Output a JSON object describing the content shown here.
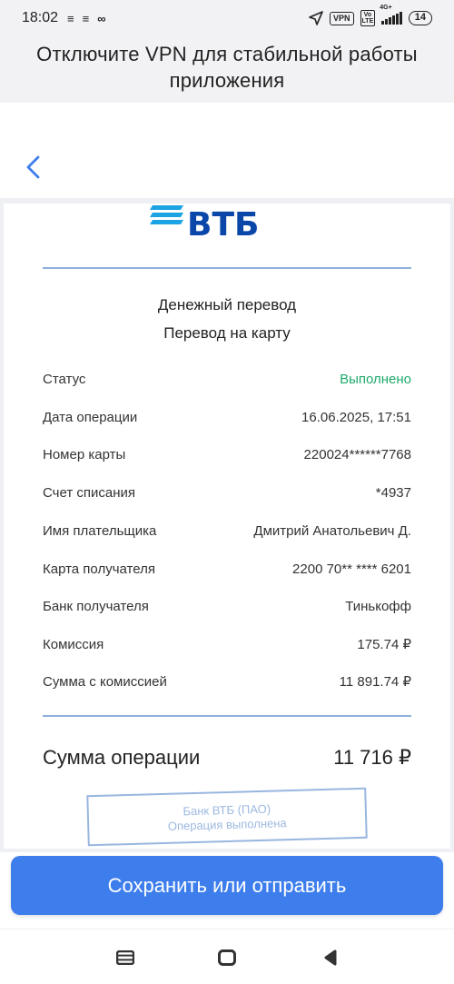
{
  "status_bar": {
    "time": "18:02",
    "notif_glyph_1": "≡",
    "notif_glyph_2": "≡",
    "notif_glyph_3": "∞",
    "vpn_chip": "VPN",
    "volte_chip_top": "Vo",
    "volte_chip_bottom": "LTE",
    "network": "4G+",
    "battery": "14",
    "icons": [
      "location-arrow-icon",
      "signal-bars-icon",
      "battery-icon"
    ]
  },
  "banner": {
    "text": "Отключите VPN для стабильной работы приложения"
  },
  "header": {
    "back_icon": "chevron-left-icon"
  },
  "receipt": {
    "logo_text": "ВТБ",
    "title": "Денежный перевод",
    "subtitle": "Перевод на карту",
    "rows": [
      {
        "label": "Статус",
        "value": "Выполнено"
      },
      {
        "label": "Дата операции",
        "value": "16.06.2025, 17:51"
      },
      {
        "label": "Номер карты",
        "value": "220024******7768"
      },
      {
        "label": "Счет списания",
        "value": "*4937"
      },
      {
        "label": "Имя плательщика",
        "value": "Дмитрий Анатольевич Д."
      },
      {
        "label": "Карта получателя",
        "value": "2200 70** **** 6201"
      },
      {
        "label": "Банк получателя",
        "value": "Тинькофф"
      },
      {
        "label": "Комиссия",
        "value": "175.74 ₽"
      },
      {
        "label": "Сумма с комиссией",
        "value": "11 891.74 ₽"
      }
    ],
    "total_label": "Сумма операции",
    "total_value": "11 716 ₽",
    "stamp_line1": "Банк ВТБ (ПАО)",
    "stamp_line2": "Операция выполнена"
  },
  "actions": {
    "save_label": "Сохранить или отправить"
  },
  "nav": {
    "icons": [
      "recent-apps-icon",
      "home-icon",
      "back-icon"
    ]
  },
  "colors": {
    "accent": "#3d7eec",
    "brand": "#0a47a8",
    "status_ok": "#1daa6a"
  }
}
